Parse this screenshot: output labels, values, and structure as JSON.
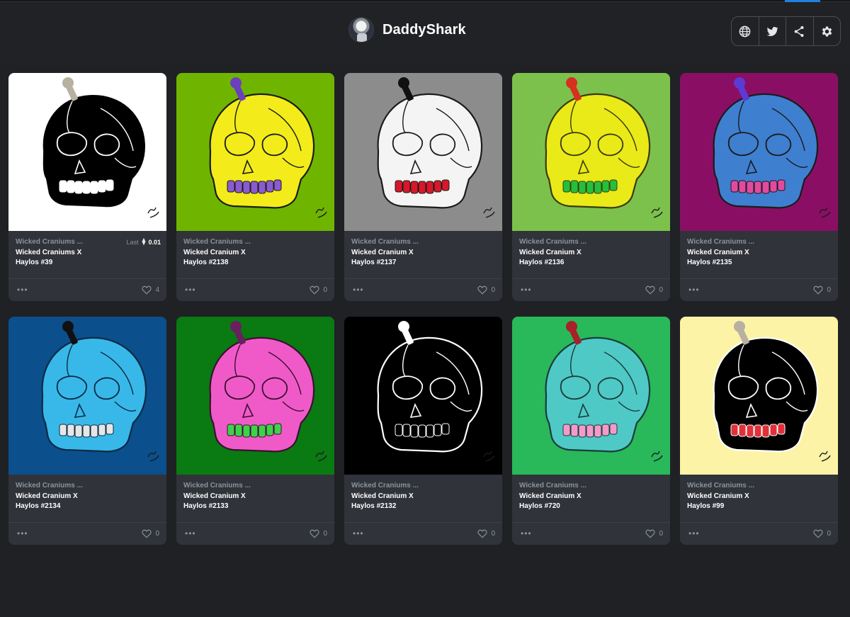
{
  "profile": {
    "name": "DaddyShark"
  },
  "actions": [
    {
      "name": "globe-icon"
    },
    {
      "name": "twitter-icon"
    },
    {
      "name": "share-icon"
    },
    {
      "name": "gear-icon"
    }
  ],
  "cards": [
    {
      "collection": "Wicked Craniums ...",
      "name": "Wicked Craniums X Haylos #39",
      "price_label": "Last",
      "price_value": "0.01",
      "likes": "4",
      "bg": "#ffffff",
      "skull": "#000000",
      "line": "#ffffff",
      "teeth": "#ffffff",
      "accent": "#b8b0a0"
    },
    {
      "collection": "Wicked Craniums ...",
      "name": "Wicked Cranium X Haylos #2138",
      "likes": "0",
      "bg": "#6fb500",
      "skull": "#f3ec1a",
      "line": "#1b1b1b",
      "teeth": "#8b5bd1",
      "accent": "#6b3fc0"
    },
    {
      "collection": "Wicked Craniums ...",
      "name": "Wicked Cranium X Haylos #2137",
      "likes": "0",
      "bg": "#8c8c8c",
      "skull": "#f4f4f4",
      "line": "#1b1b1b",
      "teeth": "#d6182a",
      "accent": "#111111"
    },
    {
      "collection": "Wicked Craniums ...",
      "name": "Wicked Cranium X Haylos #2136",
      "likes": "0",
      "bg": "#7cc14c",
      "skull": "#e9ea18",
      "line": "#3a3a10",
      "teeth": "#25c03a",
      "accent": "#d6301f"
    },
    {
      "collection": "Wicked Craniums ...",
      "name": "Wicked Cranium X Haylos #2135",
      "likes": "0",
      "bg": "#8a0f64",
      "skull": "#3f7fd0",
      "line": "#1b1b1b",
      "teeth": "#e24aa0",
      "accent": "#5b3ad6"
    },
    {
      "collection": "Wicked Craniums ...",
      "name": "Wicked Cranium X Haylos #2134",
      "likes": "0",
      "bg": "#0b4f8d",
      "skull": "#38b8e8",
      "line": "#0b2b44",
      "teeth": "#e6e6e6",
      "accent": "#111111"
    },
    {
      "collection": "Wicked Craniums ...",
      "name": "Wicked Cranium X Haylos #2133",
      "likes": "0",
      "bg": "#0a7a12",
      "skull": "#f05ac8",
      "line": "#3a1030",
      "teeth": "#3ed24a",
      "accent": "#6a1f5f"
    },
    {
      "collection": "Wicked Craniums ...",
      "name": "Wicked Cranium X Haylos #2132",
      "likes": "0",
      "bg": "#000000",
      "skull": "#000000",
      "line": "#ffffff",
      "teeth": "#000000",
      "accent": "#ffffff"
    },
    {
      "collection": "Wicked Craniums ...",
      "name": "Wicked Cranium X Haylos #720",
      "likes": "0",
      "bg": "#29b85a",
      "skull": "#4fc9c6",
      "line": "#1b3b3b",
      "teeth": "#f49acb",
      "accent": "#a8202a"
    },
    {
      "collection": "Wicked Craniums ...",
      "name": "Wicked Cranium X Haylos #99",
      "likes": "0",
      "bg": "#fdf3a6",
      "skull": "#000000",
      "line": "#ffffff",
      "teeth": "#e0313a",
      "accent": "#b8b0a0"
    }
  ],
  "colors": {
    "page_bg": "#1f2125",
    "card_bg": "#303339",
    "muted": "#8a939b"
  }
}
